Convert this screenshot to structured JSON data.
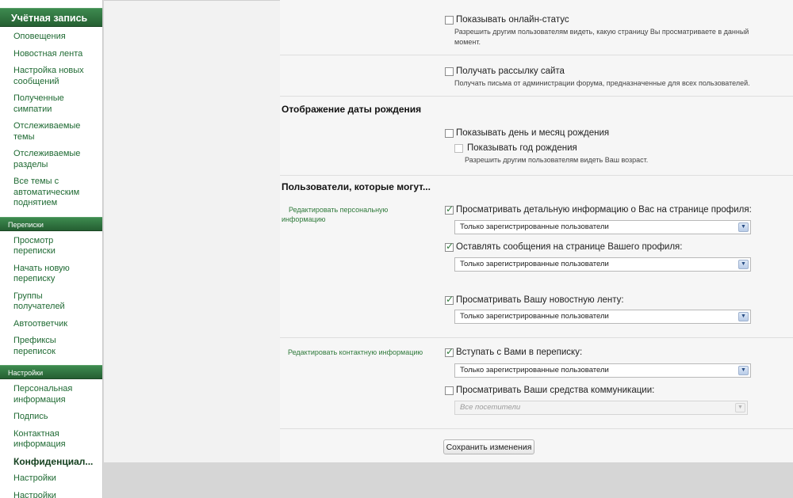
{
  "sidebar": {
    "account_header": "Учётная запись",
    "account_items": [
      "Оповещения",
      "Новостная лента",
      "Настройка новых сообщений",
      "Полученные симпатии",
      "Отслеживаемые темы",
      "Отслеживаемые разделы",
      "Все темы с автоматическим поднятием"
    ],
    "conversations_header": "Переписки",
    "conversations_items": [
      "Просмотр переписки",
      "Начать новую переписку",
      "Группы получателей",
      "Автоответчик",
      "Префиксы переписок"
    ],
    "settings_header": "Настройки",
    "settings_items": [
      "Персональная информация",
      "Подпись",
      "Контактная информация",
      "Конфиденциал...",
      "Настройки",
      "Настройки оповещений"
    ]
  },
  "privacy": {
    "online_status": {
      "label": "Показывать онлайн-статус",
      "hint_line1": "Разрешить другим пользователям видеть, какую страницу Вы просматриваете в данный",
      "hint_line2": "момент."
    },
    "mailing": {
      "label": "Получать рассылку сайта",
      "hint": "Получать письма от администрации форума, предназначенные для всех пользователей."
    },
    "birthday_section": "Отображение даты рождения",
    "show_day_month": "Показывать день и месяц рождения",
    "show_year": "Показывать год рождения",
    "birthday_hint": "Разрешить другим пользователям видеть Ваш возраст.",
    "users_section": "Пользователи, которые могут...",
    "group_personal": "Редактировать персональную информацию",
    "view_profile": "Просматривать детальную информацию о Вас на странице профиля:",
    "post_profile": "Оставлять сообщения на странице Вашего профиля:",
    "view_news": "Просматривать Вашу новостную ленту:",
    "group_contact": "Редактировать контактную информацию",
    "start_conversation": "Вступать с Вами в переписку:",
    "view_identities": "Просматривать Ваши средства коммуникации:",
    "option_registered": "Только зарегистрированные пользователи",
    "option_all_visitors": "Все посетители",
    "save_button": "Сохранить изменения"
  }
}
